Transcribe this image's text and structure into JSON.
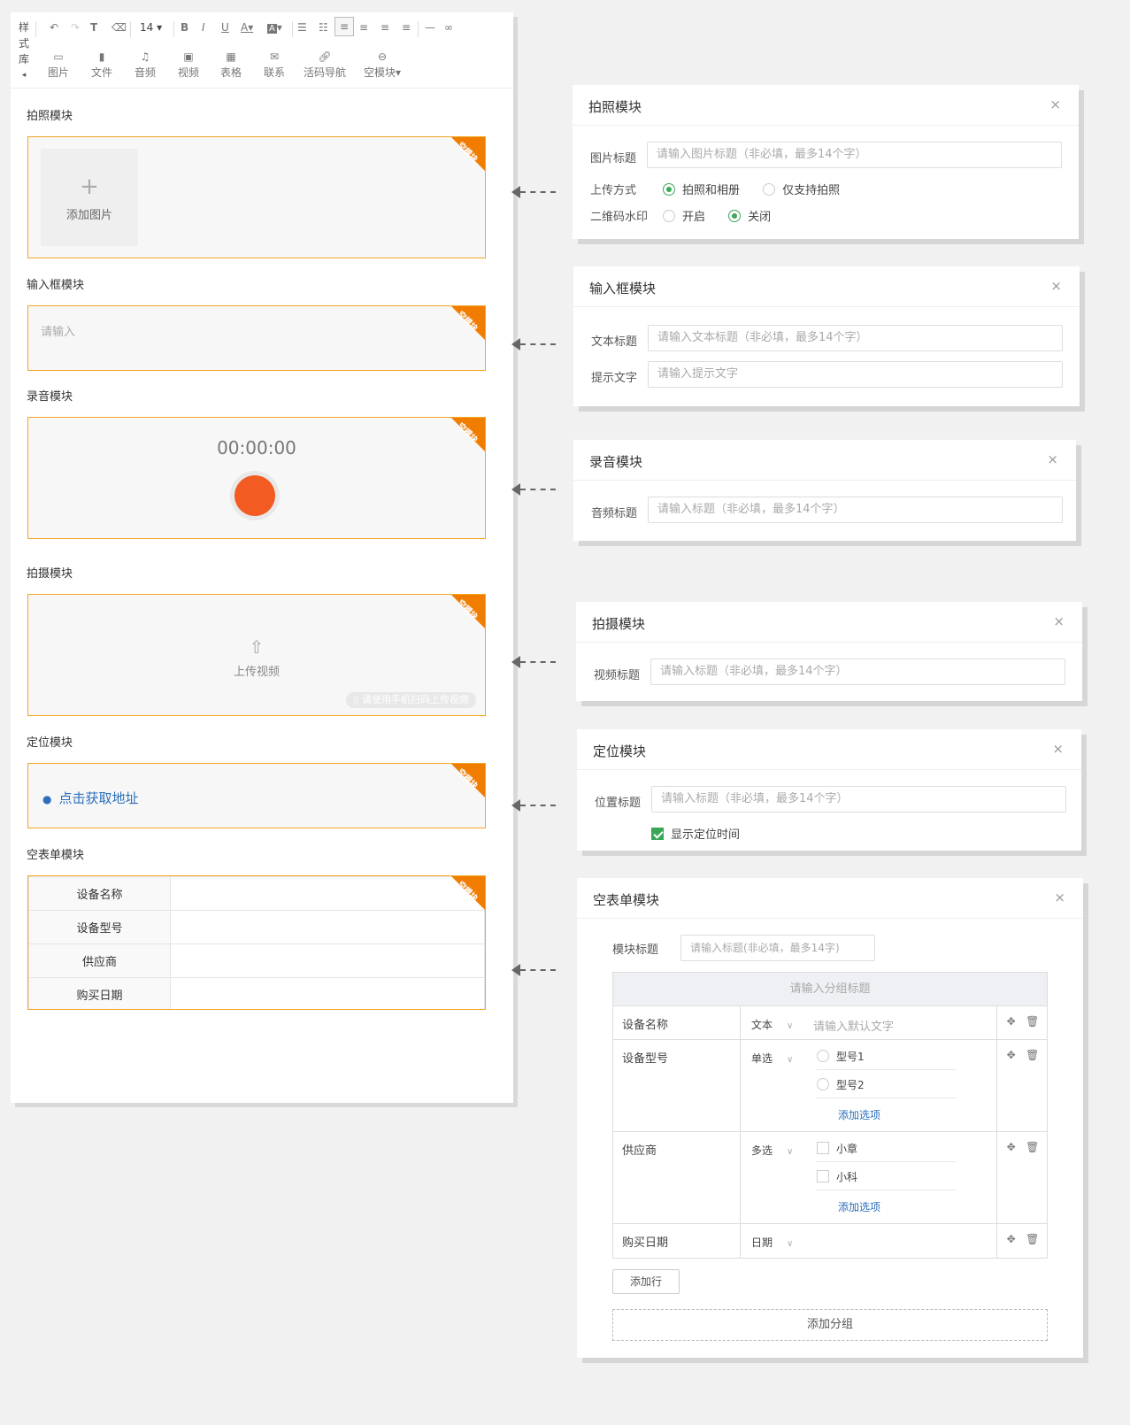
{
  "toolbar": {
    "style_lib": [
      "样",
      "式",
      "库",
      "◂"
    ],
    "font_size": "14",
    "insert_items": [
      {
        "icon": "image-icon",
        "label": "图片"
      },
      {
        "icon": "file-icon",
        "label": "文件"
      },
      {
        "icon": "music-icon",
        "label": "音频"
      },
      {
        "icon": "video-icon",
        "label": "视频"
      },
      {
        "icon": "table-icon",
        "label": "表格"
      },
      {
        "icon": "mail-icon",
        "label": "联系"
      },
      {
        "icon": "link-icon",
        "label": "活码导航"
      },
      {
        "icon": "module-icon",
        "label": "空模块"
      }
    ]
  },
  "editor": {
    "badge": "空模块",
    "photo": {
      "title": "拍照模块",
      "add_label": "添加图片"
    },
    "input": {
      "title": "输入框模块",
      "placeholder": "请输入"
    },
    "record": {
      "title": "录音模块",
      "time": "00:00:00"
    },
    "video": {
      "title": "拍摄模块",
      "upload_label": "上传视频",
      "qr_tip": "请使用手机扫码上传视频"
    },
    "location": {
      "title": "定位模块",
      "link": "点击获取地址"
    },
    "form": {
      "title": "空表单模块",
      "rows": [
        "设备名称",
        "设备型号",
        "供应商",
        "购买日期"
      ]
    }
  },
  "panels": {
    "photo": {
      "title": "拍照模块",
      "close": "×",
      "img_title_label": "图片标题",
      "img_title_placeholder": "请输入图片标题（非必填，最多14个字）",
      "upload_label": "上传方式",
      "upload_opt1": "拍照和相册",
      "upload_opt2": "仅支持拍照",
      "qr_label": "二维码水印",
      "qr_opt1": "开启",
      "qr_opt2": "关闭"
    },
    "input": {
      "title": "输入框模块",
      "close": "×",
      "text_title_label": "文本标题",
      "text_title_placeholder": "请输入文本标题（非必填，最多14个字）",
      "hint_label": "提示文字",
      "hint_placeholder": "请输入提示文字"
    },
    "record": {
      "title": "录音模块",
      "close": "×",
      "audio_label": "音频标题",
      "audio_placeholder": "请输入标题（非必填，最多14个字）"
    },
    "video": {
      "title": "拍摄模块",
      "close": "×",
      "video_label": "视频标题",
      "video_placeholder": "请输入标题（非必填，最多14个字）"
    },
    "location": {
      "title": "定位模块",
      "close": "×",
      "pos_label": "位置标题",
      "pos_placeholder": "请输入标题（非必填，最多14个字）",
      "show_time": "显示定位时间"
    },
    "form": {
      "title": "空表单模块",
      "close": "×",
      "module_label": "模块标题",
      "module_placeholder": "请输入标题(非必填，最多14字)",
      "group_placeholder": "请输入分组标题",
      "rows": [
        {
          "name": "设备名称",
          "type": "文本",
          "default": "请输入默认文字"
        },
        {
          "name": "设备型号",
          "type": "单选",
          "options": [
            "型号1",
            "型号2"
          ],
          "add": "添加选项"
        },
        {
          "name": "供应商",
          "type": "多选",
          "options": [
            "小章",
            "小科"
          ],
          "add": "添加选项"
        },
        {
          "name": "购买日期",
          "type": "日期"
        }
      ],
      "add_row": "添加行",
      "add_group": "添加分组"
    }
  }
}
